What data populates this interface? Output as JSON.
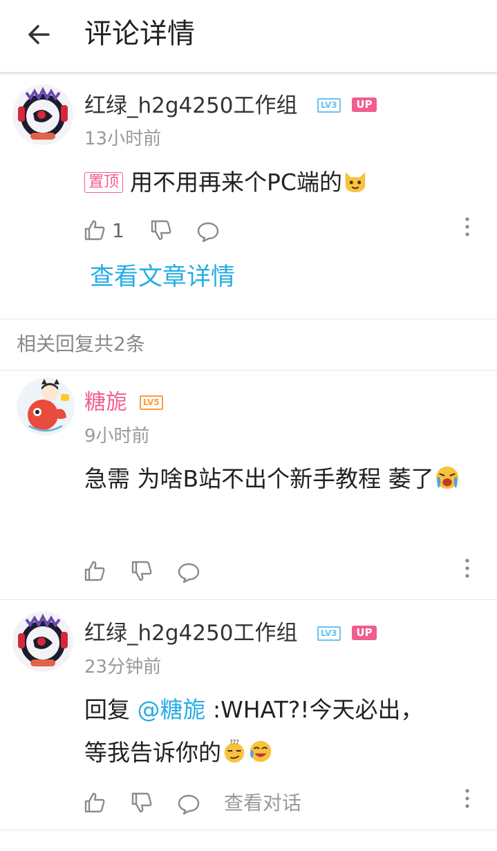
{
  "header": {
    "title": "评论详情",
    "back_icon": "arrow-left-icon"
  },
  "root_comment": {
    "username": "红绿_h2g4250工作组",
    "level": "LV3",
    "up_badge": "UP",
    "time": "13小时前",
    "pin_label": "置顶",
    "text": "用不用再来个PC端的",
    "emoji": "cat-face-emoji",
    "like_count": "1",
    "view_article": "查看文章详情"
  },
  "replies_header": "相关回复共2条",
  "replies": [
    {
      "username": "糖旎",
      "level": "LV5",
      "time": "9小时前",
      "text": "急需 为啥B站不出个新手教程 萎了",
      "emoji": "crying-face-emoji"
    },
    {
      "username": "红绿_h2g4250工作组",
      "level": "LV3",
      "up_badge": "UP",
      "time": "23分钟前",
      "reply_prefix": "回复 ",
      "mention": "@糖旎",
      "text_line1": " :WHAT?!今天必出，",
      "text_line2": "等我告诉你的",
      "emojis": [
        "thinking-face-emoji",
        "laughing-crying-emoji"
      ],
      "view_thread": "查看对话"
    }
  ],
  "colors": {
    "accent_blue": "#23ade5",
    "brand_pink": "#f25d8e",
    "lv3": "#67c3f3",
    "lv5": "#ff9c3a"
  }
}
